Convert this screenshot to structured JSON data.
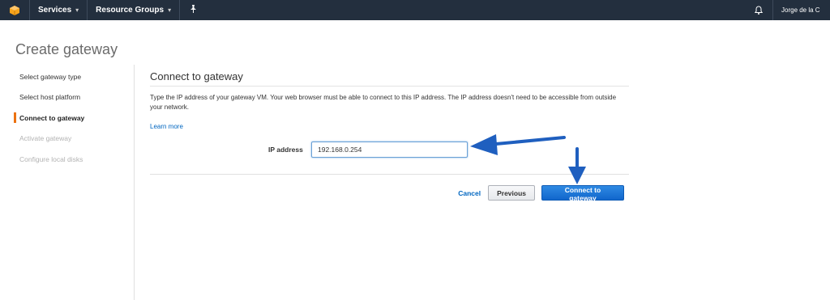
{
  "topbar": {
    "logo_icon": "aws-cube-icon",
    "services_label": "Services",
    "resource_groups_label": "Resource Groups",
    "pin_icon": "pushpin-icon",
    "bell_icon": "bell-icon",
    "user_name": "Jorge de la C"
  },
  "page": {
    "title": "Create gateway"
  },
  "steps": [
    {
      "label": "Select gateway type",
      "state": "done"
    },
    {
      "label": "Select host platform",
      "state": "done"
    },
    {
      "label": "Connect to gateway",
      "state": "active"
    },
    {
      "label": "Activate gateway",
      "state": "disabled"
    },
    {
      "label": "Configure local disks",
      "state": "disabled"
    }
  ],
  "main": {
    "heading": "Connect to gateway",
    "description": "Type the IP address of your gateway VM. Your web browser must be able to connect to this IP address. The IP address doesn't need to be accessible from outside your network.",
    "learn_more": "Learn more",
    "ip_label": "IP address",
    "ip_value": "192.168.0.254"
  },
  "actions": {
    "cancel": "Cancel",
    "previous": "Previous",
    "connect": "Connect to gateway"
  },
  "colors": {
    "topbar": "#232f3e",
    "accent": "#ec7211",
    "primary": "#1166cc",
    "annotation_arrow": "#1f5fbf"
  }
}
